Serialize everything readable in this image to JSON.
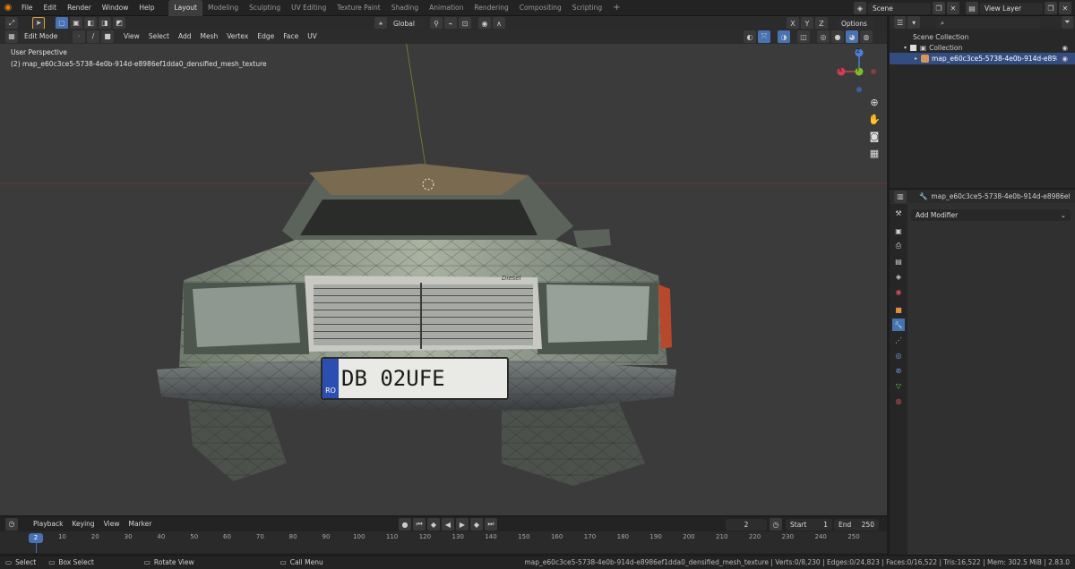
{
  "topbar": {
    "menus": [
      "File",
      "Edit",
      "Render",
      "Window",
      "Help"
    ],
    "workspaces": [
      "Layout",
      "Modeling",
      "Sculpting",
      "UV Editing",
      "Texture Paint",
      "Shading",
      "Animation",
      "Rendering",
      "Compositing",
      "Scripting"
    ],
    "active_workspace": "Layout",
    "add_tab": "+",
    "scene": "Scene",
    "view_layer": "View Layer"
  },
  "viewport": {
    "mode": "Edit Mode",
    "menus": [
      "View",
      "Select",
      "Add",
      "Mesh",
      "Vertex",
      "Edge",
      "Face",
      "UV"
    ],
    "orientation": "Global",
    "axes": [
      "X",
      "Y",
      "Z"
    ],
    "options": "Options",
    "view_name": "User Perspective",
    "object_info": "(2) map_e60c3ce5-5738-4e0b-914d-e8986ef1dda0_densified_mesh_texture",
    "gizmo": {
      "x": "X",
      "y": "Y",
      "z": "Z"
    },
    "plate": {
      "country": "RO",
      "text": "DB 02UFE"
    },
    "badge": "Diesel"
  },
  "outliner": {
    "scene_collection": "Scene Collection",
    "collection": "Collection",
    "object": "map_e60c3ce5-5738-4e0b-914d-e8986ef1dda0_densified_mesh_texture"
  },
  "properties": {
    "object_name": "map_e60c3ce5-5738-4e0b-914d-e8986ef1dda0_",
    "add_modifier": "Add Modifier"
  },
  "timeline": {
    "menus": [
      "Playback",
      "Keying",
      "View",
      "Marker"
    ],
    "current_frame": "2",
    "start_label": "Start",
    "start": "1",
    "end_label": "End",
    "end": "250",
    "ticks": [
      "2",
      "10",
      "20",
      "30",
      "40",
      "50",
      "60",
      "70",
      "80",
      "90",
      "100",
      "110",
      "120",
      "130",
      "140",
      "150",
      "160",
      "170",
      "180",
      "190",
      "200",
      "210",
      "220",
      "230",
      "240",
      "250"
    ]
  },
  "statusbar": {
    "select": "Select",
    "box_select": "Box Select",
    "rotate_view": "Rotate View",
    "call_menu": "Call Menu",
    "stats": "map_e60c3ce5-5738-4e0b-914d-e8986ef1dda0_densified_mesh_texture | Verts:0/8,230 | Edges:0/24,823 | Faces:0/16,522 | Tris:16,522 | Mem: 302.5 MiB | 2.83.0"
  }
}
